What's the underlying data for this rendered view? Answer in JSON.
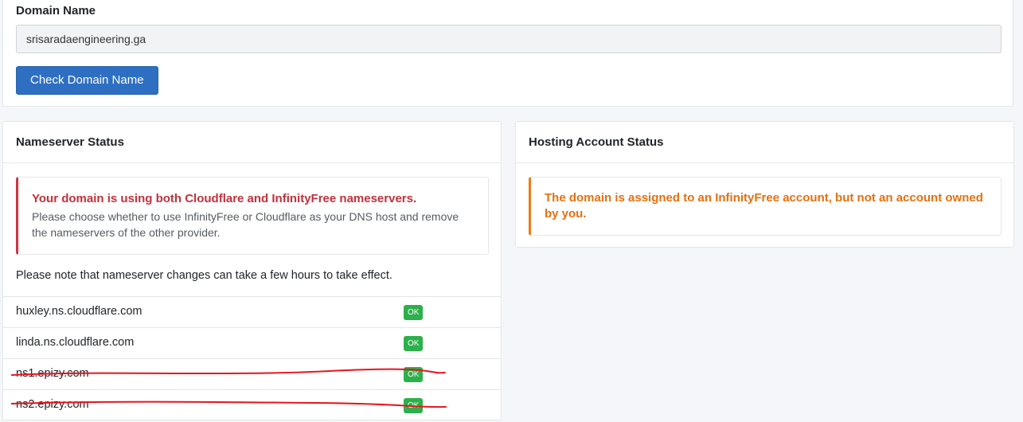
{
  "domain_form": {
    "label": "Domain Name",
    "input_value": "srisaradaengineering.ga",
    "button_label": "Check Domain Name"
  },
  "nameserver_status": {
    "title": "Nameserver Status",
    "alert_title": "Your domain is using both Cloudflare and InfinityFree nameservers.",
    "alert_body": "Please choose whether to use InfinityFree or Cloudflare as your DNS host and remove the nameservers of the other provider.",
    "note": "Please note that nameserver changes can take a few hours to take effect.",
    "nameservers": [
      {
        "name": "huxley.ns.cloudflare.com",
        "status": "OK",
        "struck": false
      },
      {
        "name": "linda.ns.cloudflare.com",
        "status": "OK",
        "struck": false
      },
      {
        "name": "ns1.epizy.com",
        "status": "OK",
        "struck": true
      },
      {
        "name": "ns2.epizy.com",
        "status": "OK",
        "struck": true
      }
    ]
  },
  "hosting_status": {
    "title": "Hosting Account Status",
    "alert_title": "The domain is assigned to an InfinityFree account, but not an account owned by you."
  },
  "colors": {
    "primary": "#2e6fc2",
    "danger": "#c0313c",
    "warning": "#e5700f",
    "success": "#2bb04a",
    "annotation": "#e8141c"
  }
}
